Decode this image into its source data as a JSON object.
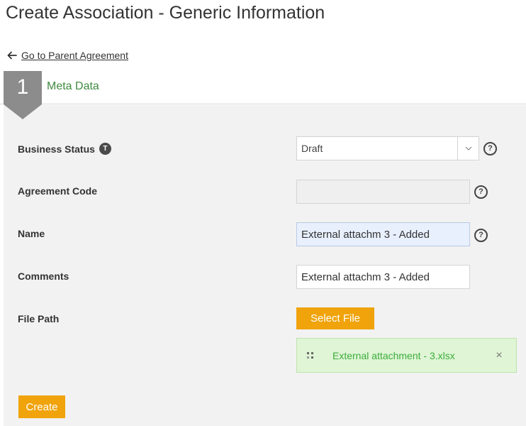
{
  "page": {
    "title": "Create Association - Generic Information"
  },
  "nav": {
    "back_link": "Go to Parent Agreement"
  },
  "step": {
    "number": "1",
    "label": "Meta Data"
  },
  "form": {
    "business_status": {
      "label": "Business Status",
      "badge": "T",
      "value": "Draft"
    },
    "agreement_code": {
      "label": "Agreement Code",
      "value": ""
    },
    "name": {
      "label": "Name",
      "value": "External attachm 3 - Added"
    },
    "comments": {
      "label": "Comments",
      "value": "External attachm 3 - Added"
    },
    "file_path": {
      "label": "File Path",
      "select_button": "Select File"
    },
    "attachment": {
      "file_name": "External attachment - 3.xlsx",
      "close": "×"
    },
    "help_glyph": "?",
    "create_button": "Create"
  },
  "colors": {
    "accent_orange": "#f0a30a",
    "step_gray": "#8c8c8c",
    "step_label_green": "#3f8a3f",
    "attachment_bg": "#dff5d5",
    "attachment_text": "#3cad3c"
  },
  "icons": [
    "arrow-left-icon",
    "info-t-icon",
    "chevron-down-icon",
    "help-icon",
    "grip-icon",
    "close-icon"
  ]
}
